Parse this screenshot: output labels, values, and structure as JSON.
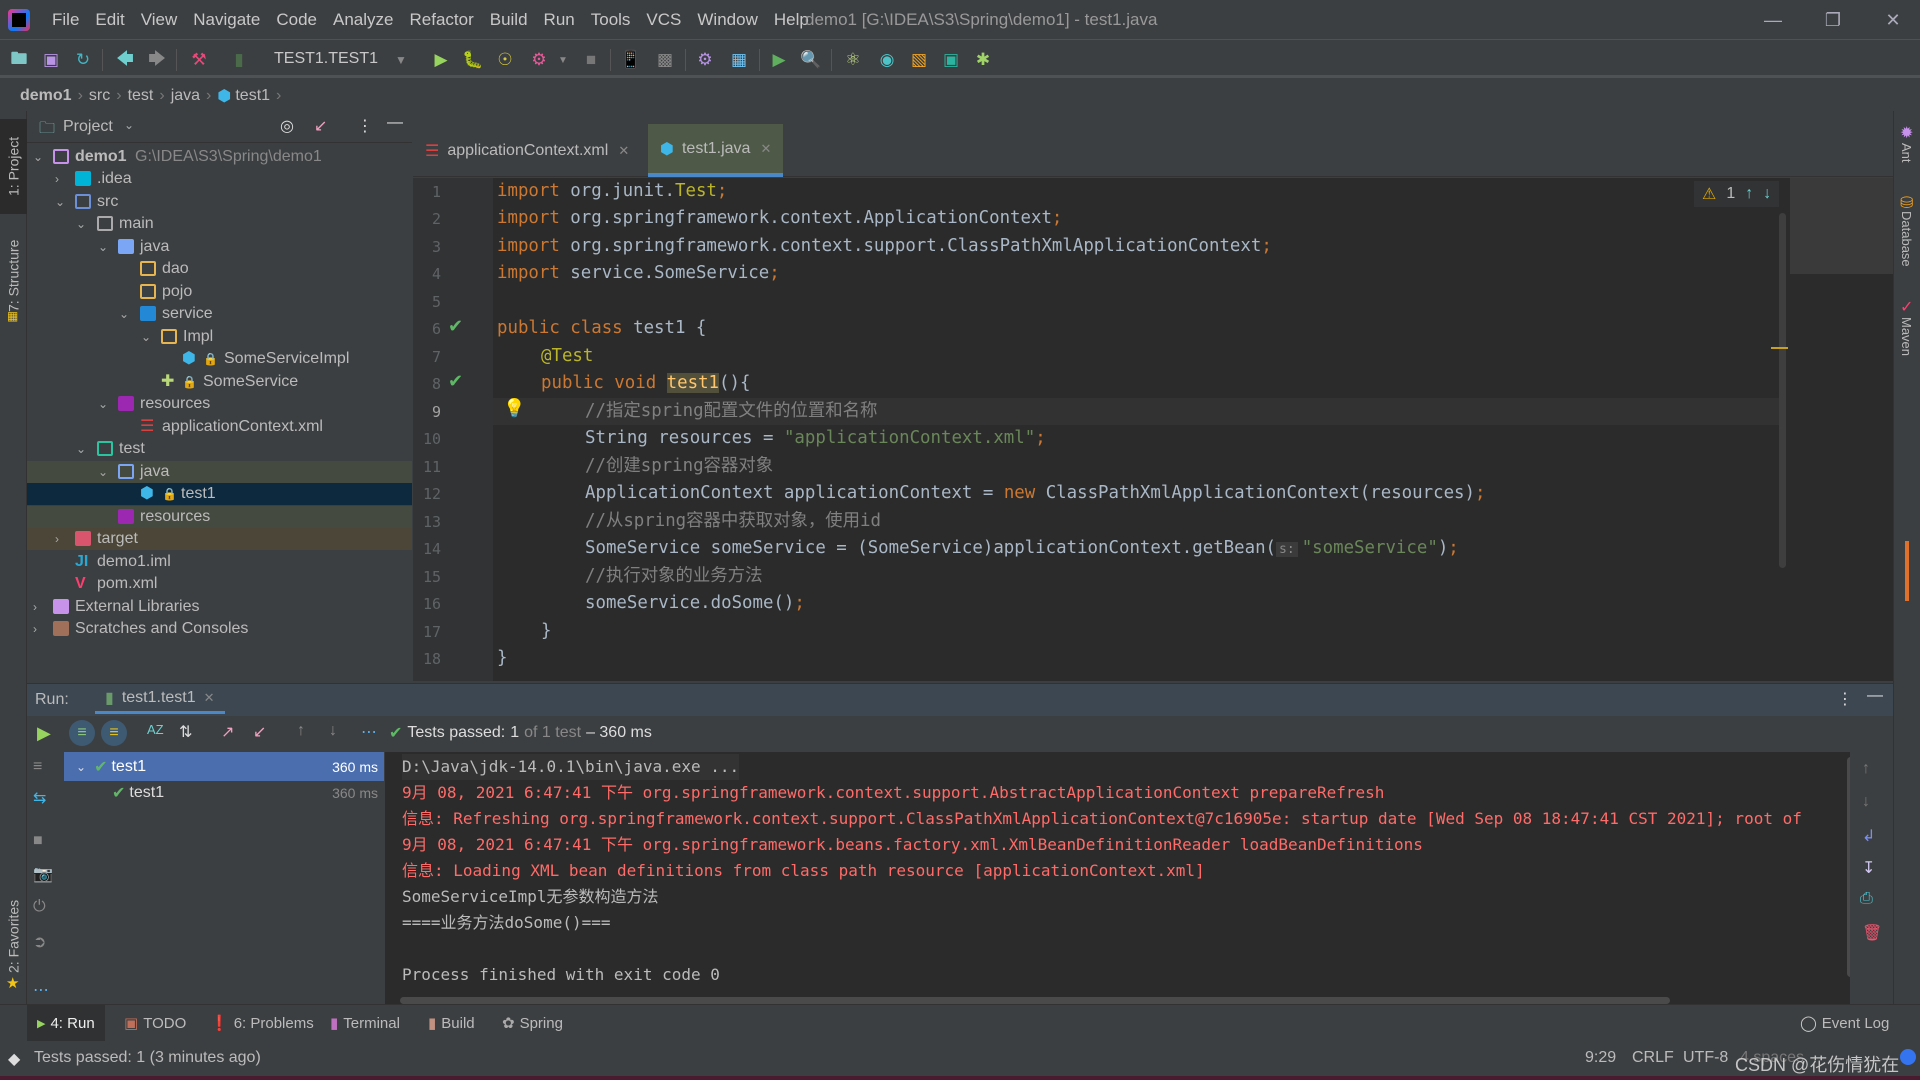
{
  "window": {
    "title": "demo1 [G:\\IDEA\\S3\\Spring\\demo1] - test1.java",
    "menu": [
      "File",
      "Edit",
      "View",
      "Navigate",
      "Code",
      "Analyze",
      "Refactor",
      "Build",
      "Run",
      "Tools",
      "VCS",
      "Window",
      "Help"
    ]
  },
  "toolbar": {
    "run_config": "TEST1.TEST1"
  },
  "breadcrumb": [
    "demo1",
    "src",
    "test",
    "java",
    "test1"
  ],
  "left_strip": {
    "project": "1: Project",
    "structure": "7: Structure",
    "favorites": "2: Favorites"
  },
  "right_strip": {
    "ant": "Ant",
    "database": "Database",
    "maven": "Maven"
  },
  "project_panel": {
    "title": "Project",
    "tree": [
      {
        "label": "demo1",
        "path": "G:\\IDEA\\S3\\Spring\\demo1",
        "depth": 0,
        "expanded": true,
        "icon": "module-folder-icon"
      },
      {
        "label": ".idea",
        "depth": 1,
        "expanded": false,
        "icon": "idea-folder-icon"
      },
      {
        "label": "src",
        "depth": 1,
        "expanded": true,
        "icon": "source-folder-icon"
      },
      {
        "label": "main",
        "depth": 2,
        "expanded": true,
        "icon": "folder-icon"
      },
      {
        "label": "java",
        "depth": 3,
        "expanded": true,
        "icon": "java-source-folder-icon"
      },
      {
        "label": "dao",
        "depth": 4,
        "icon": "package-icon"
      },
      {
        "label": "pojo",
        "depth": 4,
        "icon": "package-icon"
      },
      {
        "label": "service",
        "depth": 4,
        "expanded": true,
        "icon": "service-package-icon"
      },
      {
        "label": "Impl",
        "depth": 5,
        "expanded": true,
        "icon": "package-icon"
      },
      {
        "label": "SomeServiceImpl",
        "depth": 6,
        "icon": "class-icon"
      },
      {
        "label": "SomeService",
        "depth": 5,
        "icon": "interface-icon"
      },
      {
        "label": "resources",
        "depth": 3,
        "expanded": true,
        "icon": "resources-folder-icon"
      },
      {
        "label": "applicationContext.xml",
        "depth": 4,
        "icon": "xml-file-icon"
      },
      {
        "label": "test",
        "depth": 2,
        "expanded": true,
        "icon": "test-folder-icon"
      },
      {
        "label": "java",
        "depth": 3,
        "expanded": true,
        "icon": "test-java-folder-icon"
      },
      {
        "label": "test1",
        "depth": 4,
        "icon": "test-class-icon",
        "selected": true
      },
      {
        "label": "resources",
        "depth": 3,
        "icon": "resources-folder-icon"
      },
      {
        "label": "target",
        "depth": 1,
        "expanded": false,
        "icon": "excluded-folder-icon"
      },
      {
        "label": "demo1.iml",
        "depth": 1,
        "icon": "iml-file-icon"
      },
      {
        "label": "pom.xml",
        "depth": 1,
        "icon": "maven-file-icon"
      },
      {
        "label": "External Libraries",
        "depth": 0,
        "expanded": false,
        "icon": "libraries-icon"
      },
      {
        "label": "Scratches and Consoles",
        "depth": 0,
        "expanded": false,
        "icon": "scratches-icon"
      }
    ]
  },
  "editor": {
    "tabs": [
      {
        "label": "applicationContext.xml",
        "active": false
      },
      {
        "label": "test1.java",
        "active": true
      }
    ],
    "warnings": "1",
    "lines": [
      "1",
      "2",
      "3",
      "4",
      "5",
      "6",
      "7",
      "8",
      "9",
      "10",
      "11",
      "12",
      "13",
      "14",
      "15",
      "16",
      "17",
      "18"
    ],
    "code": {
      "l1": [
        "import",
        " org.junit.",
        "Test",
        ";"
      ],
      "l2": [
        "import",
        " org.springframework.context.ApplicationContext",
        ";"
      ],
      "l3": [
        "import",
        " org.springframework.context.support.ClassPathXmlApplicationContext",
        ";"
      ],
      "l4": [
        "import",
        " service.SomeService",
        ";"
      ],
      "l6": [
        "public class",
        " test1 {"
      ],
      "l7": "@Test",
      "l8": [
        "public void",
        " ",
        "test1",
        "(){"
      ],
      "l9": "//指定spring配置文件的位置和名称",
      "l10": [
        "String resources = ",
        "\"applicationContext.xml\"",
        ";"
      ],
      "l11": "//创建spring容器对象",
      "l12": [
        "ApplicationContext applicationContext = ",
        "new",
        " ClassPathXmlApplicationContext(resources)",
        ";"
      ],
      "l13": "//从spring容器中获取对象，使用id",
      "l14": [
        "SomeService someService = (SomeService)applicationContext.getBean(",
        "s:",
        "\"someService\"",
        ")",
        ";"
      ],
      "l15": "//执行对象的业务方法",
      "l16": [
        "someService.doSome()",
        ";"
      ],
      "l17": "}",
      "l18": "}"
    }
  },
  "run_panel": {
    "label": "Run:",
    "tab": "test1.test1",
    "status_prefix": "Tests passed:",
    "status_count": "1",
    "status_of": "of 1 test",
    "status_time": "– 360 ms",
    "tests": [
      {
        "name": "test1",
        "time": "360 ms",
        "level": 0
      },
      {
        "name": "test1",
        "time": "360 ms",
        "level": 1
      }
    ],
    "console": [
      {
        "text": "D:\\Java\\jdk-14.0.1\\bin\\java.exe ...",
        "type": "cmd"
      },
      {
        "text": "9月 08, 2021 6:47:41 下午 org.springframework.context.support.AbstractApplicationContext prepareRefresh",
        "type": "err"
      },
      {
        "text": "信息: Refreshing org.springframework.context.support.ClassPathXmlApplicationContext@7c16905e: startup date [Wed Sep 08 18:47:41 CST 2021]; root of",
        "type": "err"
      },
      {
        "text": "9月 08, 2021 6:47:41 下午 org.springframework.beans.factory.xml.XmlBeanDefinitionReader loadBeanDefinitions",
        "type": "err"
      },
      {
        "text": "信息: Loading XML bean definitions from class path resource [applicationContext.xml]",
        "type": "err"
      },
      {
        "text": "SomeServiceImpl无参数构造方法",
        "type": "out"
      },
      {
        "text": "====业务方法doSome()===",
        "type": "out"
      },
      {
        "text": "",
        "type": "out"
      },
      {
        "text": "Process finished with exit code 0",
        "type": "out"
      }
    ]
  },
  "tool_windows": [
    "4: Run",
    "TODO",
    "6: Problems",
    "Terminal",
    "Build",
    "Spring"
  ],
  "event_log": "Event Log",
  "status_bar": {
    "message": "Tests passed: 1 (3 minutes ago)",
    "position": "9:29",
    "line_sep": "CRLF",
    "encoding": "UTF-8",
    "indent": "4 spaces",
    "watermark": "CSDN @花伤情犹在"
  },
  "colors": {
    "keyword": "#cc7832",
    "string": "#6a8759",
    "comment": "#808080",
    "annotation": "#bbb529",
    "error_output": "#ff6b68",
    "accent": "#4a88c7"
  }
}
